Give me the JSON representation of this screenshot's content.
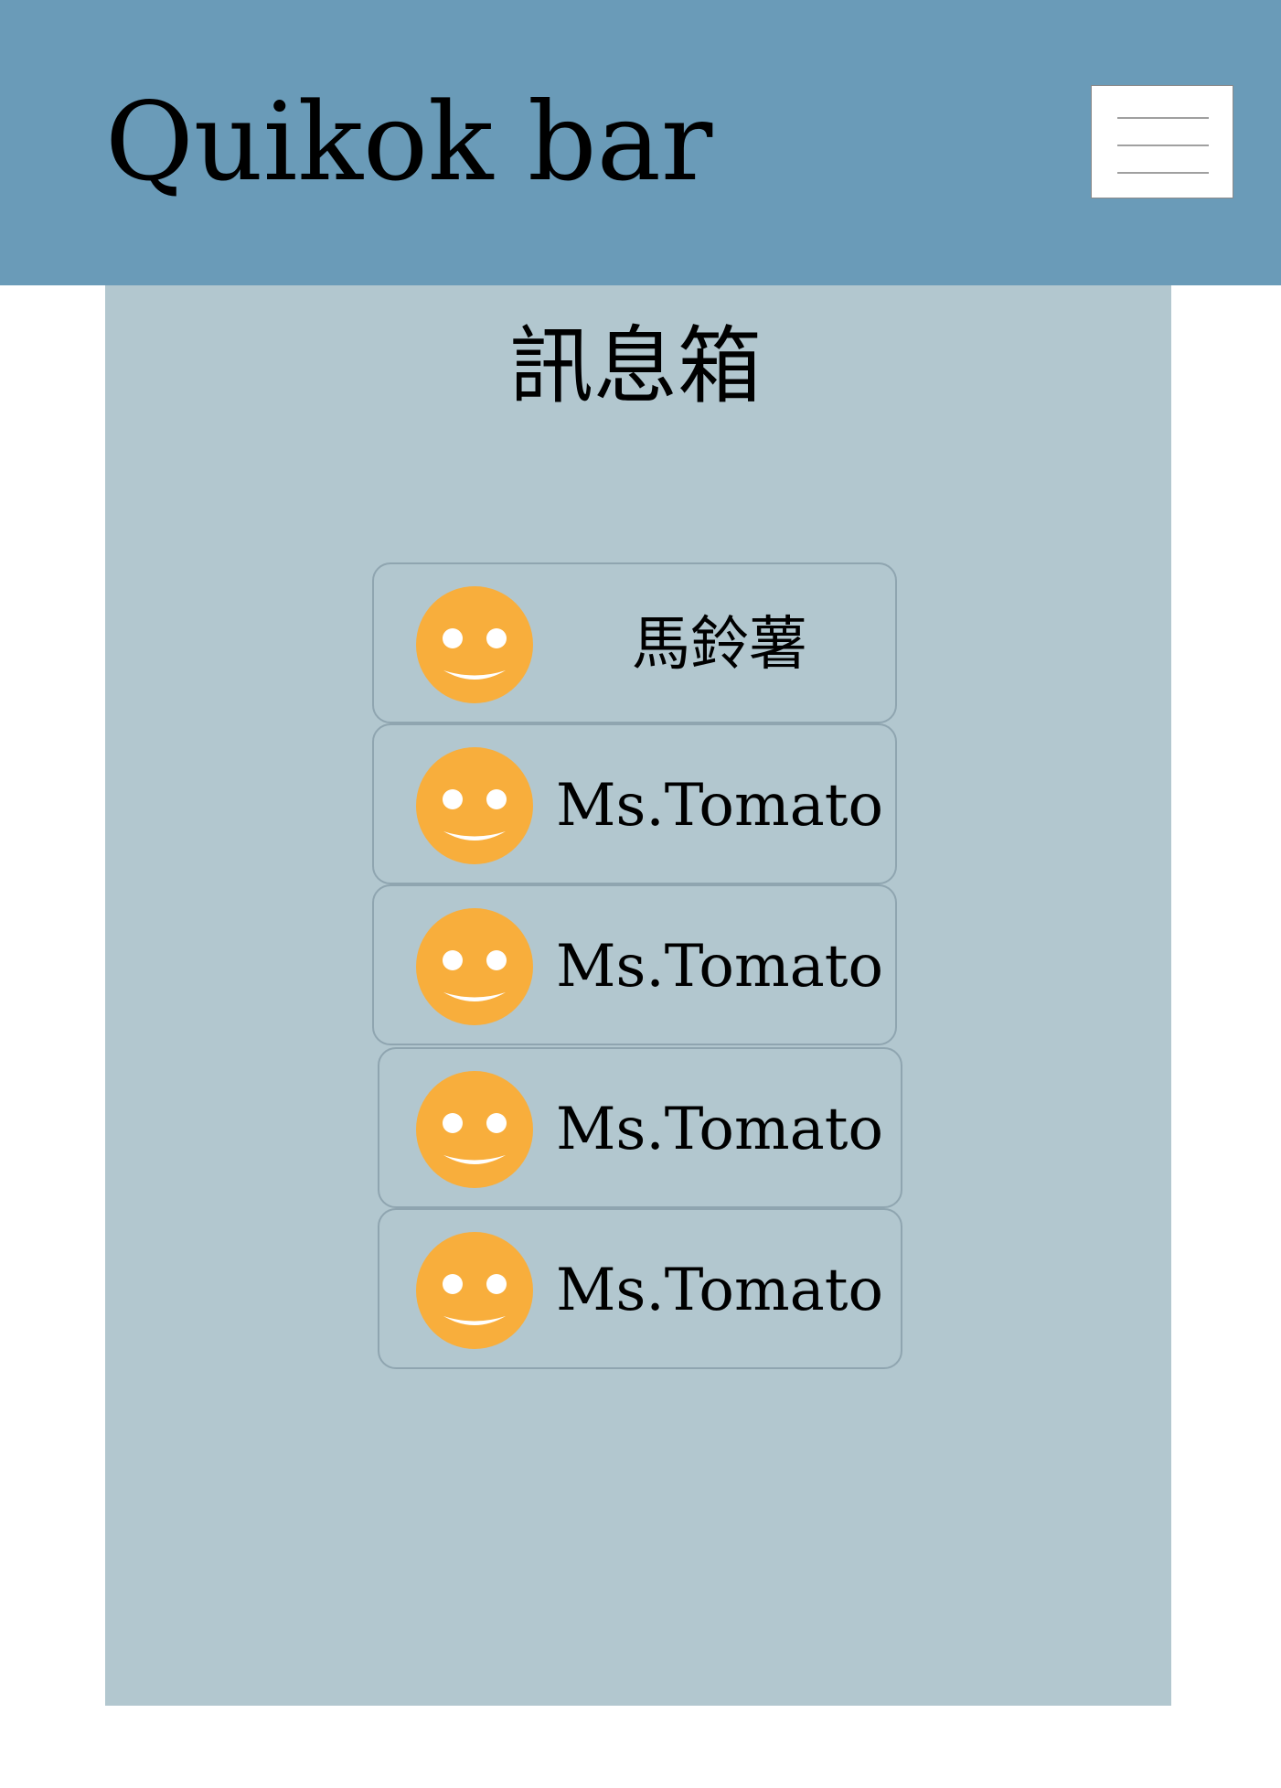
{
  "header": {
    "app_title": "Quikok bar",
    "menu_icon": "hamburger-menu-icon"
  },
  "inbox": {
    "title": "訊息箱",
    "messages": [
      {
        "sender": "馬鈴薯",
        "avatar_icon": "smiley-face-icon"
      },
      {
        "sender": "Ms.Tomato",
        "avatar_icon": "smiley-face-icon"
      },
      {
        "sender": "Ms.Tomato",
        "avatar_icon": "smiley-face-icon"
      },
      {
        "sender": "Ms.Tomato",
        "avatar_icon": "smiley-face-icon"
      },
      {
        "sender": "Ms.Tomato",
        "avatar_icon": "smiley-face-icon"
      }
    ]
  },
  "colors": {
    "header_bg": "#6a9bb8",
    "panel_bg": "#b2c7cf",
    "avatar": "#f8ae3c",
    "item_border": "#8fa5b0"
  }
}
